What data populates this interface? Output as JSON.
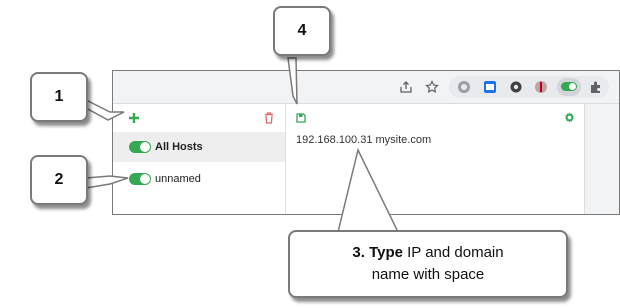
{
  "callouts": {
    "c1": "1",
    "c2": "2",
    "c3_bold": "3. Type",
    "c3_rest": " IP and domain",
    "c3_line2": "name with space",
    "c4": "4"
  },
  "sidebar": {
    "rows": [
      {
        "label": "All Hosts"
      },
      {
        "label": "unnamed"
      }
    ]
  },
  "editor": {
    "hosts_line": "192.168.100.31 mysite.com"
  },
  "colors": {
    "accent_green": "#34a853",
    "delete_red": "#e06666",
    "border_gray": "#7a7a7a"
  },
  "icons": [
    "plus-icon",
    "trash-icon",
    "save-icon",
    "gear-icon",
    "share-icon",
    "star-icon",
    "puzzle-icon"
  ]
}
